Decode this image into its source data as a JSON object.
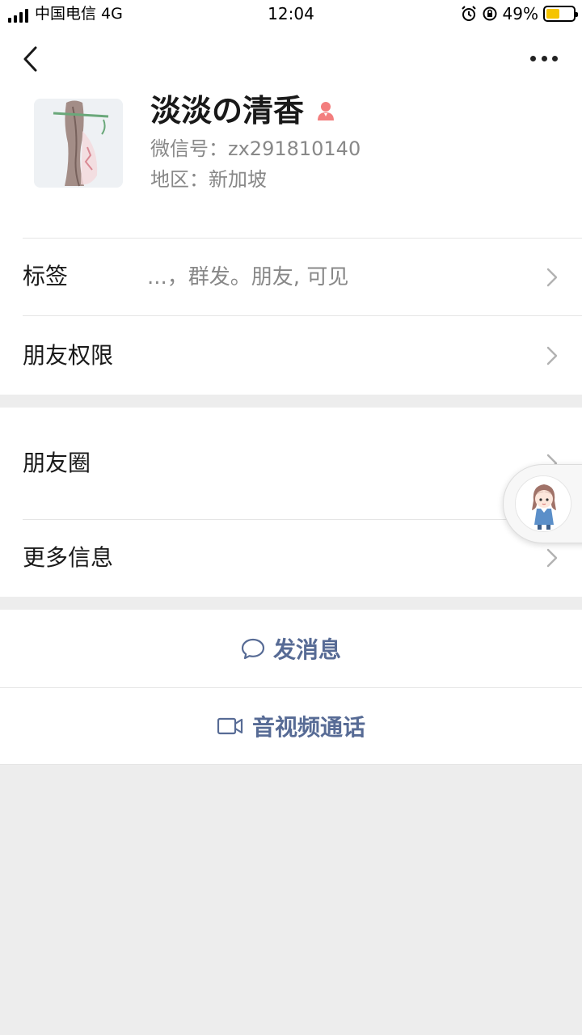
{
  "status": {
    "carrier": "中国电信 4G",
    "time": "12:04",
    "battery_pct": "49%",
    "battery_level": 0.49,
    "battery_color": "#f5c400"
  },
  "profile": {
    "name": "淡淡の清香",
    "wechat_id": "微信号：zx291810140",
    "region": "地区：新加坡",
    "gender_icon": "female-icon",
    "gender_color": "#f37e7e"
  },
  "cells": {
    "tags_label": "标签",
    "tags_value": "...，群发。朋友, 可见",
    "permissions_label": "朋友权限",
    "moments_label": "朋友圈",
    "more_info_label": "更多信息"
  },
  "actions": {
    "send_message": "发消息",
    "av_call": "音视频通话",
    "accent_color": "#576b95"
  }
}
